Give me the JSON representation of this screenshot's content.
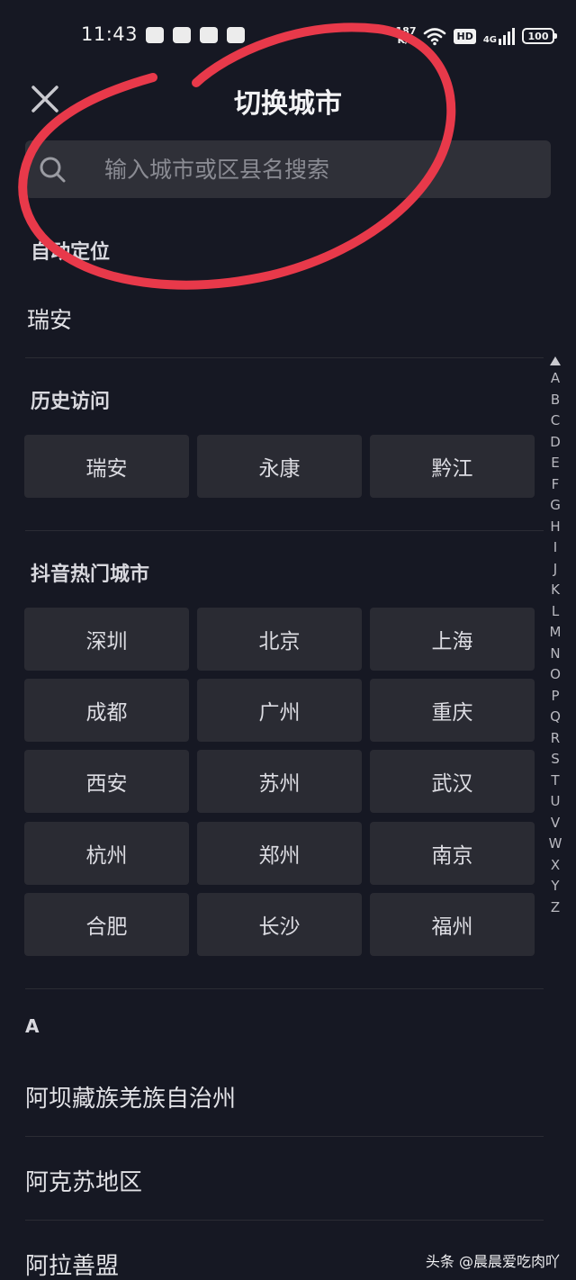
{
  "status_bar": {
    "time": "11:43",
    "net_speed_top": "187",
    "net_speed_bottom": "K/s",
    "hd": "HD",
    "network": "4G",
    "battery": "100"
  },
  "header": {
    "title": "切换城市",
    "close_icon": "close-icon"
  },
  "search": {
    "placeholder": "输入城市或区县名搜索",
    "icon": "search-icon"
  },
  "auto_location": {
    "title": "自动定位",
    "city": "瑞安"
  },
  "history": {
    "title": "历史访问",
    "cities": [
      "瑞安",
      "永康",
      "黔江"
    ]
  },
  "hot": {
    "title": "抖音热门城市",
    "cities": [
      "深圳",
      "北京",
      "上海",
      "成都",
      "广州",
      "重庆",
      "西安",
      "苏州",
      "武汉",
      "杭州",
      "郑州",
      "南京",
      "合肥",
      "长沙",
      "福州"
    ]
  },
  "alpha_index": [
    "A",
    "B",
    "C",
    "D",
    "E",
    "F",
    "G",
    "H",
    "I",
    "J",
    "K",
    "L",
    "M",
    "N",
    "O",
    "P",
    "Q",
    "R",
    "S",
    "T",
    "U",
    "V",
    "W",
    "X",
    "Y",
    "Z"
  ],
  "city_list": {
    "letter": "A",
    "cities": [
      "阿坝藏族羌族自治州",
      "阿克苏地区",
      "阿拉善盟"
    ]
  },
  "watermark": "头条 @晨晨爱吃肉吖",
  "colors": {
    "background": "#161823",
    "chip": "#2a2b33",
    "search_bg": "#2f3038",
    "annotation": "#e8394a"
  }
}
